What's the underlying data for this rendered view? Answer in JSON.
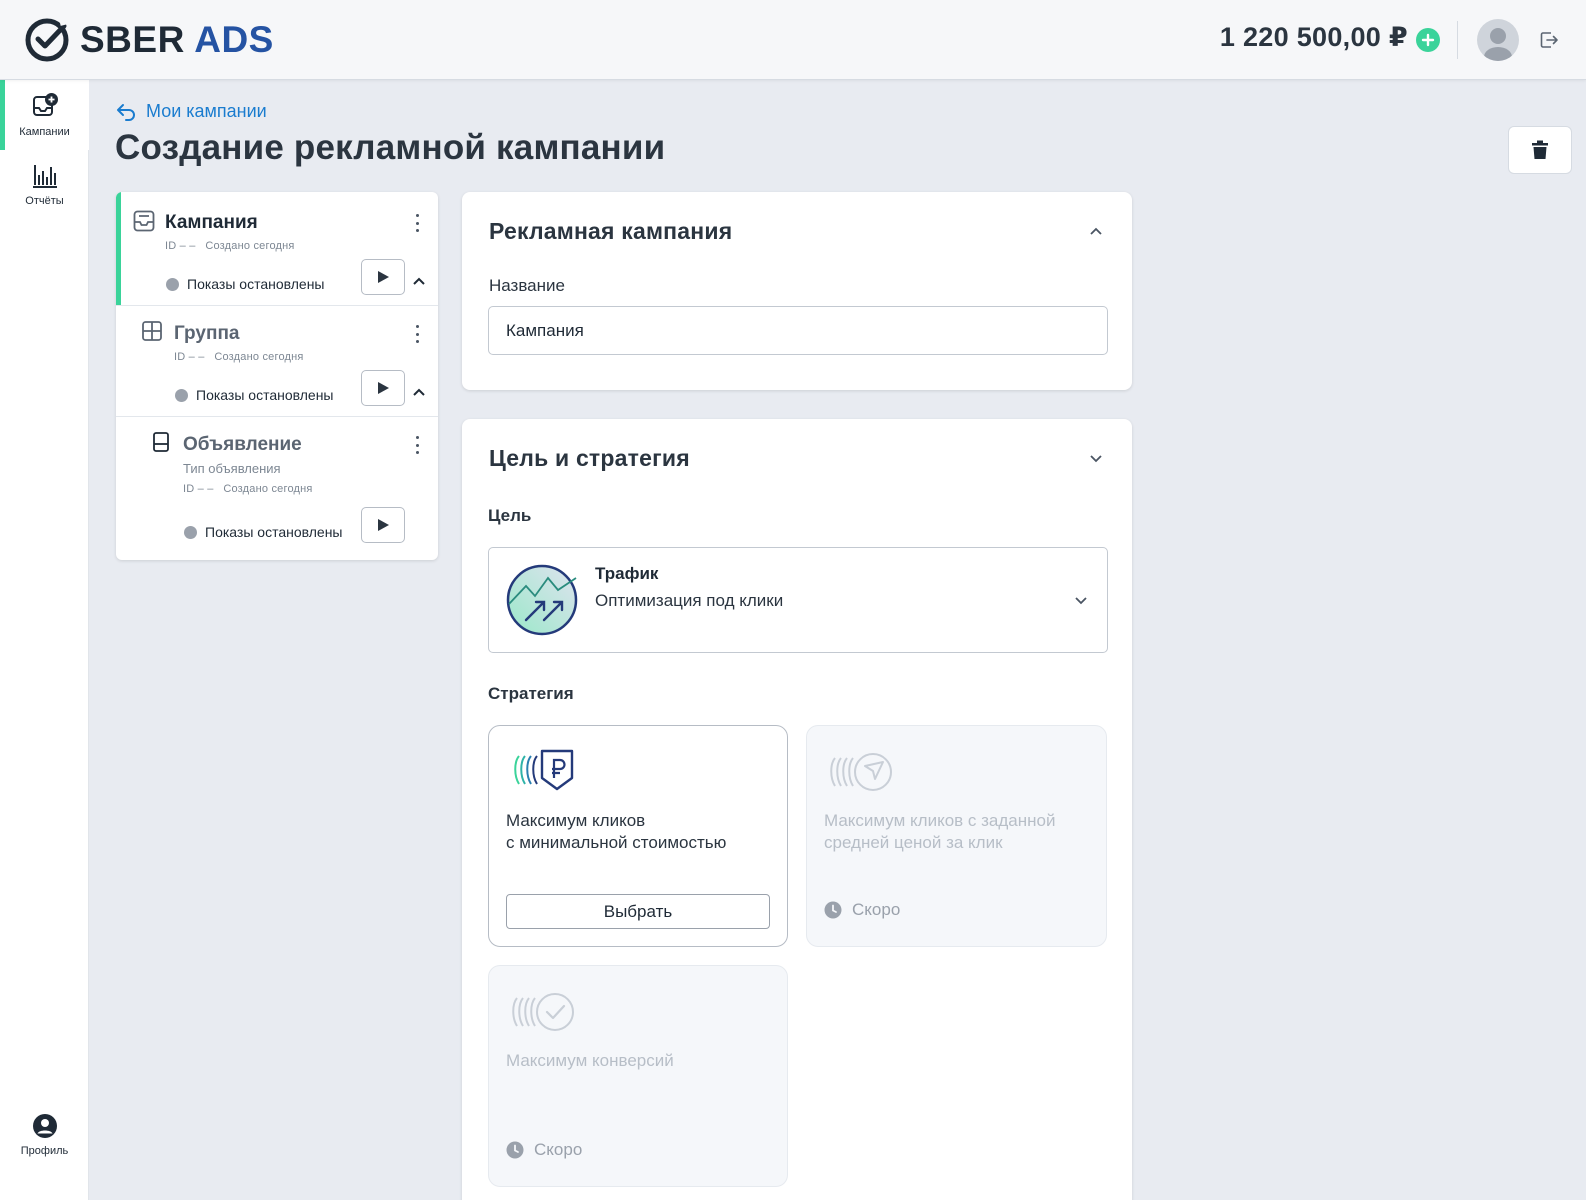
{
  "header": {
    "logo_text_sber": "SBER",
    "logo_text_ads": "ADS",
    "balance": "1 220 500,00 ₽"
  },
  "sidebar": {
    "items": [
      {
        "label": "Кампании",
        "icon": "campaigns-add-icon",
        "active": true
      },
      {
        "label": "Отчёты",
        "icon": "bar-chart-icon",
        "active": false
      }
    ],
    "profile_label": "Профиль"
  },
  "breadcrumb": {
    "back_label": "Мои кампании"
  },
  "page": {
    "title": "Создание рекламной кампании"
  },
  "tree": {
    "campaign": {
      "title": "Кампания",
      "id": "ID – –",
      "created": "Создано сегодня",
      "status": "Показы остановлены"
    },
    "group": {
      "title": "Группа",
      "id": "ID – –",
      "created": "Создано сегодня",
      "status": "Показы остановлены"
    },
    "ad": {
      "title": "Объявление",
      "type": "Тип объявления",
      "id": "ID – –",
      "created": "Создано сегодня",
      "status": "Показы остановлены"
    }
  },
  "campaign_card": {
    "title": "Рекламная кампания",
    "name_label": "Название",
    "name_value": "Кампания"
  },
  "goal_card": {
    "title": "Цель и стратегия",
    "goal_label": "Цель",
    "goal": {
      "title": "Трафик",
      "subtitle": "Оптимизация под клики"
    },
    "strategy_label": "Стратегия",
    "strategies": [
      {
        "line1": "Максимум кликов",
        "line2": "с минимальной стоимостью",
        "button": "Выбрать",
        "enabled": true
      },
      {
        "line1": "Максимум кликов с заданной",
        "line2": "средней ценой за клик",
        "soon": "Скоро",
        "enabled": false
      },
      {
        "line1": "Максимум конверсий",
        "soon": "Скоро",
        "enabled": false
      }
    ]
  },
  "colors": {
    "accent_green": "#3ad39a",
    "link_blue": "#1a7ccf",
    "brand_blue": "#2553a3",
    "background": "#e8ebf1"
  }
}
